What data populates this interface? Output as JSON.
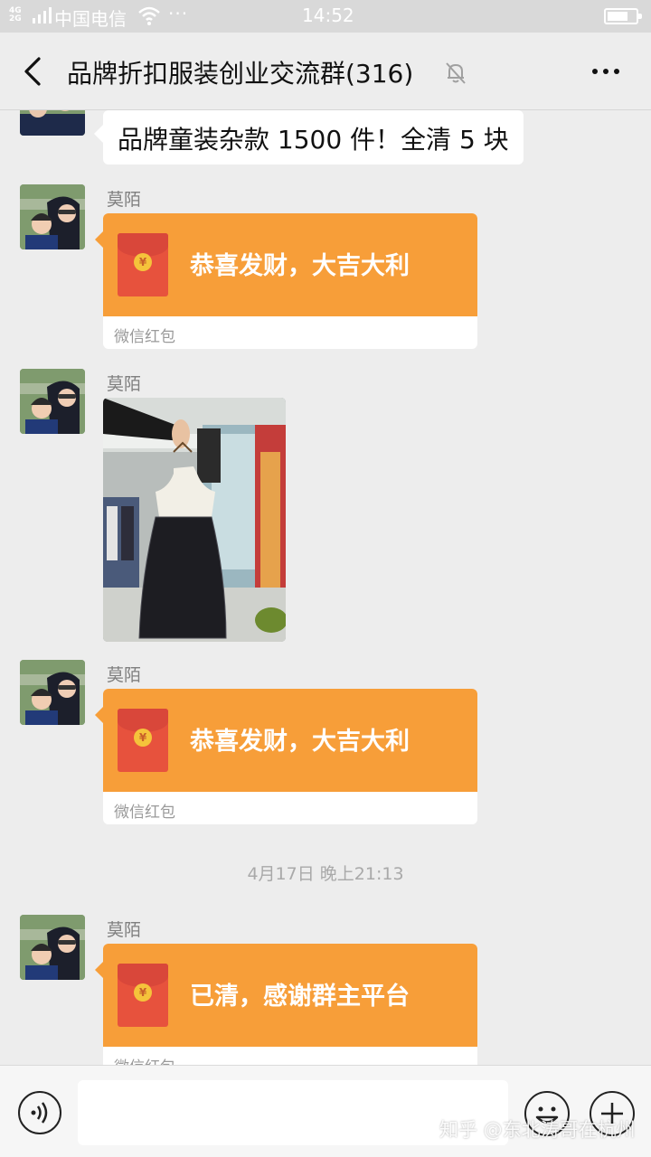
{
  "status_bar": {
    "network_top": "4G",
    "network_bottom": "2G",
    "carrier": "中国电信",
    "more": "···",
    "time": "14:52"
  },
  "header": {
    "title": "品牌折扣服装创业交流群(316)"
  },
  "messages": [
    {
      "type": "text",
      "text": "品牌童装杂款 1500 件！全清 5 块"
    },
    {
      "type": "red_packet",
      "sender": "莫陌",
      "message": "恭喜发财，大吉大利",
      "label": "微信红包"
    },
    {
      "type": "image",
      "sender": "莫陌"
    },
    {
      "type": "red_packet",
      "sender": "莫陌",
      "message": "恭喜发财，大吉大利",
      "label": "微信红包"
    },
    {
      "type": "timestamp",
      "text": "4月17日 晚上21:13"
    },
    {
      "type": "red_packet",
      "sender": "莫陌",
      "message": "已清，感谢群主平台",
      "label": "微信红包"
    }
  ],
  "input_bar": {
    "value": ""
  },
  "watermark": "知乎 @东北涛哥在杭州",
  "colors": {
    "red_packet": "#f79e39",
    "background": "#ededed"
  }
}
